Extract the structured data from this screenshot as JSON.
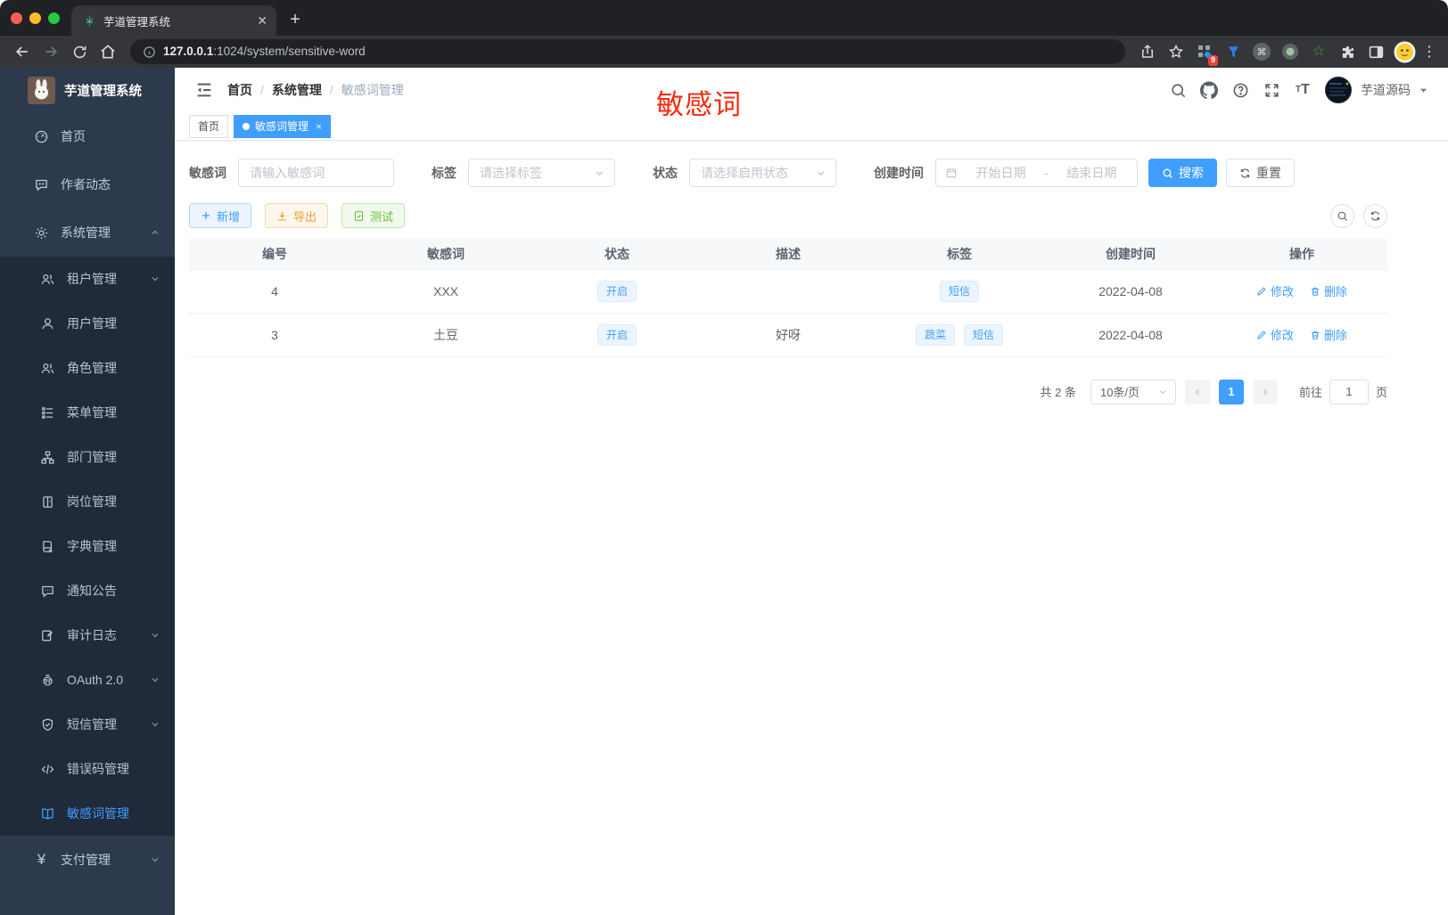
{
  "colors": {
    "primary": "#409eff",
    "success": "#67c23a",
    "warning": "#e6a23c",
    "annotation_red": "#f8290e",
    "sidebar_bg": "#2d3a4b",
    "sidebar_submenu_bg": "#1f2a3a"
  },
  "browser": {
    "tab_title": "芋道管理系统",
    "url_host": "127.0.0.1",
    "url_rest": ":1024/system/sensitive-word",
    "extension_badge": "9",
    "new_tab_label": "+",
    "tab_close_label": "✕"
  },
  "sidebar": {
    "title": "芋道管理系统",
    "items": [
      {
        "label": "首页",
        "icon": "dashboard-icon"
      },
      {
        "label": "作者动态",
        "icon": "author-chat-icon"
      },
      {
        "label": "系统管理",
        "icon": "gear-icon",
        "expanded": true
      },
      {
        "label": "租户管理",
        "icon": "tenant-users-icon",
        "chevron": "down"
      },
      {
        "label": "用户管理",
        "icon": "user-icon"
      },
      {
        "label": "角色管理",
        "icon": "role-users-icon"
      },
      {
        "label": "菜单管理",
        "icon": "menu-list-icon"
      },
      {
        "label": "部门管理",
        "icon": "org-tree-icon"
      },
      {
        "label": "岗位管理",
        "icon": "post-badge-icon"
      },
      {
        "label": "字典管理",
        "icon": "dict-book-icon"
      },
      {
        "label": "通知公告",
        "icon": "notice-bubble-icon"
      },
      {
        "label": "审计日志",
        "icon": "audit-edit-icon",
        "chevron": "down"
      },
      {
        "label": "OAuth 2.0",
        "icon": "oauth-robot-icon",
        "chevron": "down"
      },
      {
        "label": "短信管理",
        "icon": "sms-shield-icon",
        "chevron": "down"
      },
      {
        "label": "错误码管理",
        "icon": "error-code-icon"
      },
      {
        "label": "敏感词管理",
        "icon": "open-book-icon",
        "active": true
      },
      {
        "label": "支付管理",
        "icon": "yen-icon",
        "chevron": "down"
      }
    ]
  },
  "navbar": {
    "breadcrumb": [
      "首页",
      "系统管理",
      "敏感词管理"
    ],
    "separator": "/",
    "user_name": "芋道源码"
  },
  "annotation": "敏感词",
  "tags_view": {
    "home": "首页",
    "active_tag": "敏感词管理",
    "close_label": "×"
  },
  "filters": {
    "keyword": {
      "label": "敏感词",
      "placeholder": "请输入敏感词"
    },
    "tag": {
      "label": "标签",
      "placeholder": "请选择标签"
    },
    "status": {
      "label": "状态",
      "placeholder": "请选择启用状态"
    },
    "create_time": {
      "label": "创建时间",
      "start_placeholder": "开始日期",
      "separator": "-",
      "end_placeholder": "结束日期"
    },
    "search_label": "搜索",
    "reset_label": "重置"
  },
  "toolbar": {
    "add_label": "新增",
    "export_label": "导出",
    "test_label": "测试"
  },
  "table": {
    "columns": [
      "编号",
      "敏感词",
      "状态",
      "描述",
      "标签",
      "创建时间",
      "操作"
    ],
    "rows": [
      {
        "id": "4",
        "word": "XXX",
        "status": "开启",
        "description": "",
        "tags": [
          "短信"
        ],
        "create_time": "2022-04-08"
      },
      {
        "id": "3",
        "word": "土豆",
        "status": "开启",
        "description": "好呀",
        "tags": [
          "蔬菜",
          "短信"
        ],
        "create_time": "2022-04-08"
      }
    ],
    "edit_label": "修改",
    "delete_label": "删除"
  },
  "pagination": {
    "total": "共 2 条",
    "page_size": "10条/页",
    "page": "1",
    "goto_label": "前往",
    "goto_value": "1",
    "unit_label": "页"
  }
}
